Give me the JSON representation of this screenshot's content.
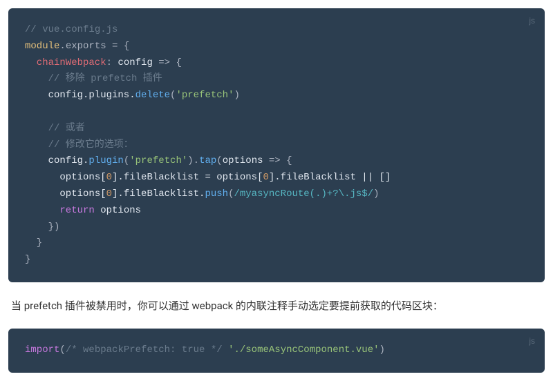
{
  "block1": {
    "lang": "js",
    "l0": "// vue.config.js",
    "l1a": "module",
    "l1b": ".exports = {",
    "l2a": "chainWebpack",
    "l2b": ": ",
    "l2c": "config",
    "l2d": " => {",
    "l3": "// 移除 prefetch 插件",
    "l4a": "config.plugins.",
    "l4b": "delete",
    "l4c": "(",
    "l4d": "'prefetch'",
    "l4e": ")",
    "l5": "// 或者",
    "l6": "// 修改它的选项：",
    "l7a": "config.",
    "l7b": "plugin",
    "l7c": "(",
    "l7d": "'prefetch'",
    "l7e": ").",
    "l7f": "tap",
    "l7g": "(",
    "l7h": "options",
    "l7i": " => {",
    "l8a": "options[",
    "l8b": "0",
    "l8c": "].fileBlacklist = options[",
    "l8d": "0",
    "l8e": "].fileBlacklist || []",
    "l9a": "options[",
    "l9b": "0",
    "l9c": "].fileBlacklist.",
    "l9d": "push",
    "l9e": "(",
    "l9f": "/myasyncRoute(.)+?\\.js$/",
    "l9g": ")",
    "l10a": "return",
    "l10b": " options",
    "l11": "})",
    "l12": "}",
    "l13": "}"
  },
  "prose": "当 prefetch 插件被禁用时，你可以通过 webpack 的内联注释手动选定要提前获取的代码区块：",
  "block2": {
    "lang": "js",
    "l0a": "import",
    "l0b": "(",
    "l0c": "/* webpackPrefetch: true */",
    "l0d": " ",
    "l0e": "'./someAsyncComponent.vue'",
    "l0f": ")"
  }
}
